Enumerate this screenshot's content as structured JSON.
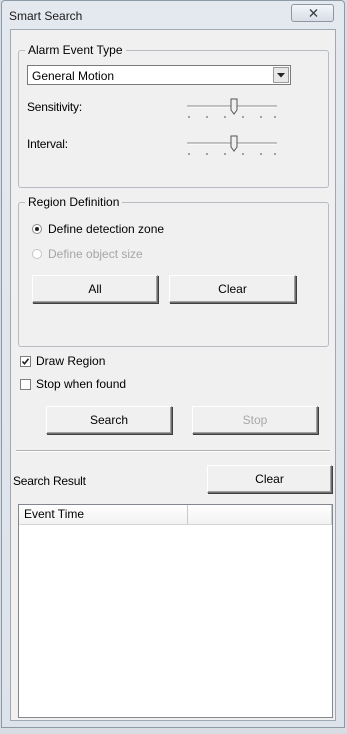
{
  "window": {
    "title": "Smart Search"
  },
  "alarm_group": {
    "title": "Alarm Event Type",
    "event_type_value": "General Motion",
    "sensitivity_label": "Sensitivity:",
    "interval_label": "Interval:"
  },
  "region_group": {
    "title": "Region Definition",
    "option_detection_zone": "Define detection zone",
    "option_object_size": "Define object size",
    "all_label": "All",
    "clear_label": "Clear"
  },
  "options": {
    "draw_region_label": "Draw Region",
    "draw_region_checked": true,
    "stop_when_found_label": "Stop when found",
    "stop_when_found_checked": false
  },
  "actions": {
    "search_label": "Search",
    "stop_label": "Stop"
  },
  "results": {
    "title": "Search Result",
    "clear_label": "Clear",
    "columns": [
      "Event Time",
      ""
    ],
    "rows": []
  }
}
